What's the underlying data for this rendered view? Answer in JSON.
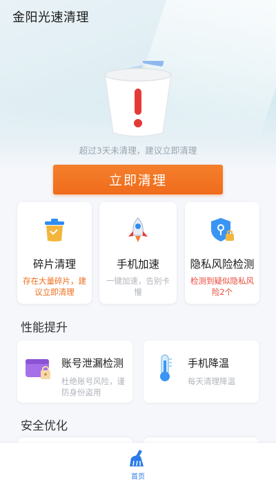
{
  "header": {
    "title": "金阳光速清理"
  },
  "hero": {
    "tip": "超过3天未清理，建议立即清理",
    "button_label": "立即清理"
  },
  "features": [
    {
      "title": "碎片清理",
      "desc": "存在大量碎片，建议立即清理",
      "icon": "trash-can-icon"
    },
    {
      "title": "手机加速",
      "desc": "一键加速，告别卡慢",
      "icon": "rocket-icon"
    },
    {
      "title": "隐私风险检测",
      "desc": "检测到疑似隐私风险2个",
      "icon": "shield-lock-icon"
    }
  ],
  "performance": {
    "title": "性能提升",
    "items": [
      {
        "title": "账号泄漏检测",
        "desc": "杜绝账号风险，谨防身份盗用",
        "icon": "wallet-lock-icon"
      },
      {
        "title": "手机降温",
        "desc": "每天清理降温",
        "icon": "thermometer-icon"
      }
    ]
  },
  "security": {
    "title": "安全优化"
  },
  "nav": {
    "home_label": "首页"
  },
  "colors": {
    "accent_orange": "#ef6c1c",
    "alert_red": "#e94a3b",
    "nav_blue": "#2b7be8"
  }
}
